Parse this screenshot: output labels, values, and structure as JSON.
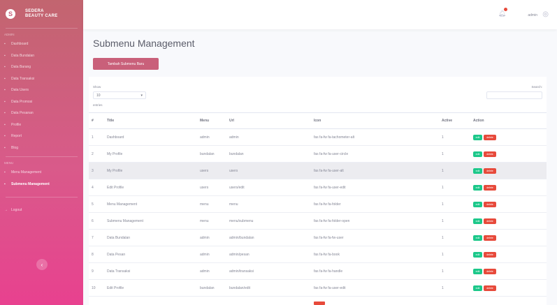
{
  "brand": {
    "logo_letter": "S",
    "name_line1": "SEDERA",
    "name_line2": "BEAUTY CARE"
  },
  "sidebar": {
    "heading_main": "Admin",
    "items": [
      {
        "label": "Dashboard",
        "icon": "gauge-icon"
      },
      {
        "label": "Data Bundalan",
        "icon": "list-icon"
      },
      {
        "label": "Data Barang",
        "icon": "box-icon"
      },
      {
        "label": "Data Transaksi",
        "icon": "cart-icon"
      },
      {
        "label": "Data Users",
        "icon": "users-icon"
      },
      {
        "label": "Data Promosi",
        "icon": "tag-icon"
      },
      {
        "label": "Data Pesanan",
        "icon": "receipt-icon"
      },
      {
        "label": "Profile",
        "icon": "user-icon"
      },
      {
        "label": "Report",
        "icon": "chart-icon"
      },
      {
        "label": "Blog",
        "icon": "book-icon"
      }
    ],
    "heading_menu": "Menu",
    "menu_items": [
      {
        "label": "Menu Management",
        "icon": "folder-icon",
        "active": false
      },
      {
        "label": "Submenu Management",
        "icon": "folder-open-icon",
        "active": true
      }
    ],
    "logout_label": "Logout",
    "toggle_icon": "chevron-left-icon"
  },
  "topbar": {
    "user_name": "admin",
    "bell_icon": "bell-icon",
    "avatar_icon": "user-circle-icon"
  },
  "page": {
    "title": "Submenu Management",
    "add_button": "Tambah Submenu Baru"
  },
  "table_controls": {
    "show_label": "Show",
    "entries_value": "10",
    "entries_label": "entries",
    "search_label": "Search:"
  },
  "table": {
    "headers": [
      "#",
      "Title",
      "Menu",
      "Url",
      "Icon",
      "Active",
      "Action"
    ],
    "edit_label": "edit",
    "delete_label": "delete",
    "rows": [
      [
        "1",
        "Dashboard",
        "admin",
        "admin",
        "fas fa-fw fa-tachometer-alt",
        "1"
      ],
      [
        "2",
        "My Profile",
        "bundalan",
        "bundalan",
        "fas fa-fw fa-user-circle",
        "1"
      ],
      [
        "3",
        "My Profile",
        "users",
        "users",
        "fas fa-fw fa-user-alt",
        "1"
      ],
      [
        "4",
        "Edit Profile",
        "users",
        "users/edit",
        "fas fa-fw fa-user-edit",
        "1"
      ],
      [
        "5",
        "Menu Management",
        "menu",
        "menu",
        "fas fa-fw fa-folder",
        "1"
      ],
      [
        "6",
        "Submenu Management",
        "menu",
        "menu/submenu",
        "fas fa-fw fa-folder-open",
        "1"
      ],
      [
        "7",
        "Data Bundalan",
        "admin",
        "admin/bundalan",
        "fas fa-fw fa-fw-user",
        "1"
      ],
      [
        "8",
        "Data Pesan",
        "admin",
        "admin/pesan",
        "fas fa-fw fa-book",
        "1"
      ],
      [
        "9",
        "Data Transaksi",
        "admin",
        "admin/transaksi",
        "fas fa-fw fa-handle",
        "1"
      ],
      [
        "10",
        "Edit Profile",
        "bundalan",
        "bundalan/edit",
        "fas fa-fw fa-user-edit",
        "1"
      ]
    ]
  },
  "colors": {
    "sidebar_top": "#c2656f",
    "sidebar_bottom": "#e8418f",
    "accent": "#c9607a",
    "edit": "#1cc88a",
    "delete": "#e74a3b"
  }
}
